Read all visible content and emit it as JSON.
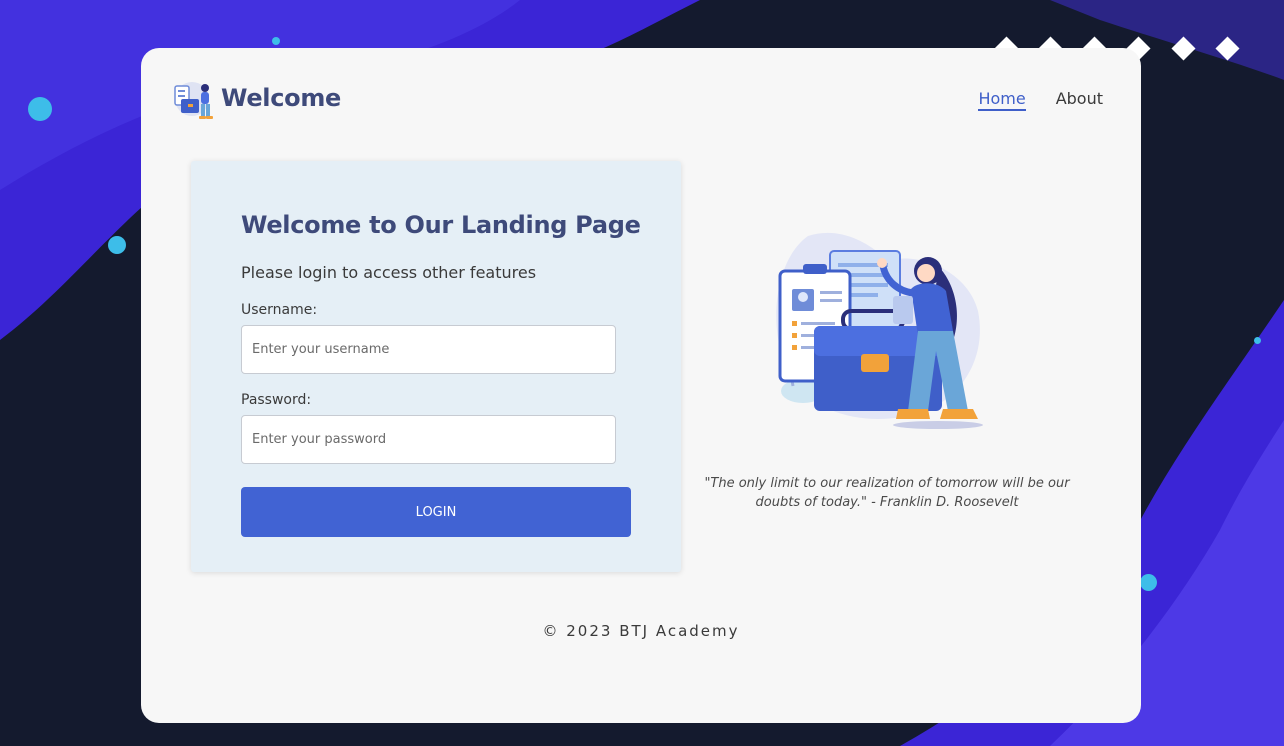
{
  "header": {
    "brand": "Welcome",
    "nav": [
      {
        "label": "Home",
        "active": true
      },
      {
        "label": "About",
        "active": false
      }
    ]
  },
  "login": {
    "title": "Welcome to Our Landing Page",
    "subtitle": "Please login to access other features",
    "username_label": "Username:",
    "username_placeholder": "Enter your username",
    "password_label": "Password:",
    "password_placeholder": "Enter your password",
    "button_label": "LOGIN"
  },
  "quote": "\"The only limit to our realization of tomorrow will be our doubts of today.\" - Franklin D. Roosevelt",
  "footer": "© 2023 BTJ Academy",
  "colors": {
    "accent": "#4163d3",
    "heading": "#3e4a7a",
    "background_dark": "#141a2e",
    "background_wave": "#3b25d6",
    "panel": "#e5eff6",
    "card": "#f7f7f7"
  },
  "icons": {
    "logo": "briefcase-woman-logo-icon",
    "illustration": "woman-with-briefcase-illustration"
  }
}
